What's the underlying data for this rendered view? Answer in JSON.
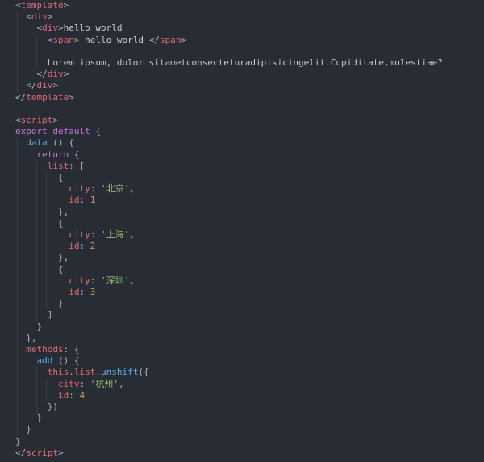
{
  "lines": [
    [
      {
        "t": "<",
        "c": "punc"
      },
      {
        "t": "template",
        "c": "tag"
      },
      {
        "t": ">",
        "c": "punc"
      }
    ],
    [
      {
        "t": "  "
      },
      {
        "t": "<",
        "c": "punc"
      },
      {
        "t": "div",
        "c": "tag"
      },
      {
        "t": ">",
        "c": "punc"
      }
    ],
    [
      {
        "t": "    "
      },
      {
        "t": "<",
        "c": "punc"
      },
      {
        "t": "div",
        "c": "tag"
      },
      {
        "t": ">",
        "c": "punc"
      },
      {
        "t": "hello world",
        "c": "text"
      }
    ],
    [
      {
        "t": "      "
      },
      {
        "t": "<",
        "c": "punc"
      },
      {
        "t": "span",
        "c": "tag"
      },
      {
        "t": ">",
        "c": "punc"
      },
      {
        "t": " hello world ",
        "c": "text"
      },
      {
        "t": "</",
        "c": "punc"
      },
      {
        "t": "span",
        "c": "tag"
      },
      {
        "t": ">",
        "c": "punc"
      }
    ],
    [],
    [
      {
        "t": "      "
      },
      {
        "t": "Lorem ipsum, dolor sitametconsecteturadipisicingelit.Cupiditate,molestiae?",
        "c": "text"
      }
    ],
    [
      {
        "t": "    "
      },
      {
        "t": "</",
        "c": "punc"
      },
      {
        "t": "div",
        "c": "tag"
      },
      {
        "t": ">",
        "c": "punc"
      }
    ],
    [
      {
        "t": "  "
      },
      {
        "t": "</",
        "c": "punc"
      },
      {
        "t": "div",
        "c": "tag"
      },
      {
        "t": ">",
        "c": "punc"
      }
    ],
    [
      {
        "t": "</",
        "c": "punc"
      },
      {
        "t": "template",
        "c": "tag"
      },
      {
        "t": ">",
        "c": "punc"
      }
    ],
    [],
    [
      {
        "t": "<",
        "c": "punc"
      },
      {
        "t": "script",
        "c": "tag"
      },
      {
        "t": ">",
        "c": "punc"
      }
    ],
    [
      {
        "t": "export ",
        "c": "kw"
      },
      {
        "t": "default ",
        "c": "kw"
      },
      {
        "t": "{",
        "c": "plain"
      }
    ],
    [
      {
        "t": "  "
      },
      {
        "t": "data",
        "c": "fn"
      },
      {
        "t": " () {",
        "c": "plain"
      }
    ],
    [
      {
        "t": "    "
      },
      {
        "t": "return",
        "c": "kw"
      },
      {
        "t": " {",
        "c": "plain"
      }
    ],
    [
      {
        "t": "      "
      },
      {
        "t": "list",
        "c": "key"
      },
      {
        "t": ": [",
        "c": "plain"
      }
    ],
    [
      {
        "t": "        "
      },
      {
        "t": "{",
        "c": "plain"
      }
    ],
    [
      {
        "t": "          "
      },
      {
        "t": "city",
        "c": "key"
      },
      {
        "t": ": ",
        "c": "plain"
      },
      {
        "t": "'北京'",
        "c": "str"
      },
      {
        "t": ",",
        "c": "plain"
      }
    ],
    [
      {
        "t": "          "
      },
      {
        "t": "id",
        "c": "key"
      },
      {
        "t": ": ",
        "c": "plain"
      },
      {
        "t": "1",
        "c": "num"
      }
    ],
    [
      {
        "t": "        "
      },
      {
        "t": "},",
        "c": "plain"
      }
    ],
    [
      {
        "t": "        "
      },
      {
        "t": "{",
        "c": "plain"
      }
    ],
    [
      {
        "t": "          "
      },
      {
        "t": "city",
        "c": "key"
      },
      {
        "t": ": ",
        "c": "plain"
      },
      {
        "t": "'上海'",
        "c": "str"
      },
      {
        "t": ",",
        "c": "plain"
      }
    ],
    [
      {
        "t": "          "
      },
      {
        "t": "id",
        "c": "key"
      },
      {
        "t": ": ",
        "c": "plain"
      },
      {
        "t": "2",
        "c": "num"
      }
    ],
    [
      {
        "t": "        "
      },
      {
        "t": "},",
        "c": "plain"
      }
    ],
    [
      {
        "t": "        "
      },
      {
        "t": "{",
        "c": "plain"
      }
    ],
    [
      {
        "t": "          "
      },
      {
        "t": "city",
        "c": "key"
      },
      {
        "t": ": ",
        "c": "plain"
      },
      {
        "t": "'深圳'",
        "c": "str"
      },
      {
        "t": ",",
        "c": "plain"
      }
    ],
    [
      {
        "t": "          "
      },
      {
        "t": "id",
        "c": "key"
      },
      {
        "t": ": ",
        "c": "plain"
      },
      {
        "t": "3",
        "c": "num"
      }
    ],
    [
      {
        "t": "        "
      },
      {
        "t": "}",
        "c": "plain"
      }
    ],
    [
      {
        "t": "      "
      },
      {
        "t": "]",
        "c": "plain"
      }
    ],
    [
      {
        "t": "    "
      },
      {
        "t": "}",
        "c": "plain"
      }
    ],
    [
      {
        "t": "  "
      },
      {
        "t": "},",
        "c": "plain"
      }
    ],
    [
      {
        "t": "  "
      },
      {
        "t": "methods",
        "c": "key"
      },
      {
        "t": ": {",
        "c": "plain"
      }
    ],
    [
      {
        "t": "    "
      },
      {
        "t": "add",
        "c": "fn"
      },
      {
        "t": " () {",
        "c": "plain"
      }
    ],
    [
      {
        "t": "      "
      },
      {
        "t": "this",
        "c": "key"
      },
      {
        "t": ".",
        "c": "plain"
      },
      {
        "t": "list",
        "c": "key"
      },
      {
        "t": ".",
        "c": "plain"
      },
      {
        "t": "unshift",
        "c": "fn"
      },
      {
        "t": "({",
        "c": "plain"
      }
    ],
    [
      {
        "t": "        "
      },
      {
        "t": "city",
        "c": "key"
      },
      {
        "t": ": ",
        "c": "plain"
      },
      {
        "t": "'杭州'",
        "c": "str"
      },
      {
        "t": ",",
        "c": "plain"
      }
    ],
    [
      {
        "t": "        "
      },
      {
        "t": "id",
        "c": "key"
      },
      {
        "t": ": ",
        "c": "plain"
      },
      {
        "t": "4",
        "c": "num"
      }
    ],
    [
      {
        "t": "      "
      },
      {
        "t": "})",
        "c": "plain"
      }
    ],
    [
      {
        "t": "    "
      },
      {
        "t": "}",
        "c": "plain"
      }
    ],
    [
      {
        "t": "  "
      },
      {
        "t": "}",
        "c": "plain"
      }
    ],
    [
      {
        "t": "}",
        "c": "plain"
      }
    ],
    [
      {
        "t": "</",
        "c": "punc"
      },
      {
        "t": "script",
        "c": "tag"
      },
      {
        "t": ">",
        "c": "punc"
      }
    ]
  ]
}
